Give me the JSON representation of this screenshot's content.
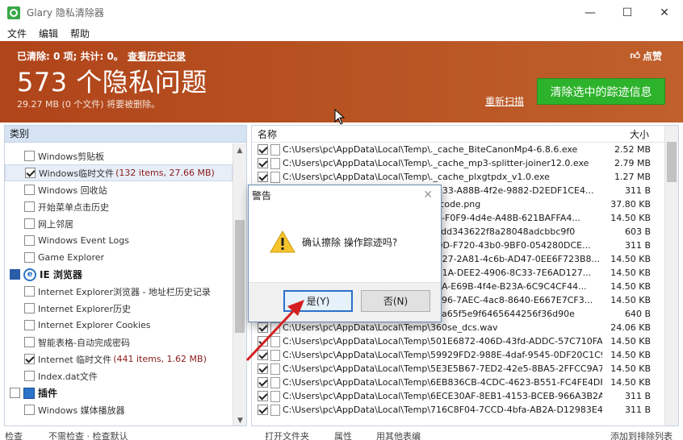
{
  "window": {
    "title": "Glary 隐私清除器",
    "controls": [
      "—",
      "☐",
      "✕"
    ]
  },
  "menu": [
    "文件",
    "编辑",
    "帮助"
  ],
  "banner": {
    "summary": "已清除: 0 项; 共计: 0。",
    "history_link": "查看历史记录",
    "like": "点赞",
    "count": "573 个隐私问题",
    "sub": "29.27 MB (0 个文件) 将要被删除。",
    "rescan": "重新扫描",
    "clean_button": "清除选中的踪迹信息"
  },
  "left_panel": {
    "header": "类别",
    "items": [
      {
        "label": "Windows剪贴板",
        "checked": false,
        "extra": ""
      },
      {
        "label": "Windows临时文件",
        "checked": true,
        "extra": "(132 items, 27.66 MB)",
        "selected": true
      },
      {
        "label": "Windows 回收站",
        "checked": false,
        "extra": ""
      },
      {
        "label": "开始菜单点击历史",
        "checked": false,
        "extra": ""
      },
      {
        "label": "网上邻居",
        "checked": false,
        "extra": ""
      },
      {
        "label": "Windows Event Logs",
        "checked": false,
        "extra": ""
      },
      {
        "label": "Game Explorer",
        "checked": false,
        "extra": ""
      }
    ],
    "group_ie": "IE 浏览器",
    "ie_items": [
      {
        "label": "Internet Explorer浏览器 - 地址栏历史记录",
        "checked": false,
        "extra": ""
      },
      {
        "label": "Internet Explorer历史",
        "checked": false,
        "extra": ""
      },
      {
        "label": "Internet Explorer Cookies",
        "checked": false,
        "extra": ""
      },
      {
        "label": "智能表格-自动完成密码",
        "checked": false,
        "extra": ""
      },
      {
        "label": "Internet 临时文件",
        "checked": true,
        "extra": "(441 items, 1.62 MB)"
      },
      {
        "label": "Index.dat文件",
        "checked": false,
        "extra": ""
      }
    ],
    "group_plugins": "插件",
    "plugin_items": [
      {
        "label": "Windows 媒体播放器",
        "checked": false,
        "extra": ""
      }
    ]
  },
  "right_panel": {
    "col_name": "名称",
    "col_size": "大小",
    "rows": [
      {
        "path": "C:\\Users\\pc\\AppData\\Local\\Temp\\._cache_BiteCanonMp4-6.8.6.exe",
        "size": "2.52 MB"
      },
      {
        "path": "C:\\Users\\pc\\AppData\\Local\\Temp\\._cache_mp3-splitter-joiner12.0.exe",
        "size": "2.79 MB"
      },
      {
        "path": "C:\\Users\\pc\\AppData\\Local\\Temp\\._cache_plxgtpdx_v1.0.exe",
        "size": "1.27 MB"
      },
      {
        "path": "C:\\Users\\pc\\AppData\\Local\\Temp\\FD33-A88B-4f2e-9882-D2EDF1CE4...",
        "size": "311 B"
      },
      {
        "path": "C:\\Users\\pc\\AppData\\Local\\Temp\\qrcode.png",
        "size": "37.80 KB"
      },
      {
        "path": "C:\\Users\\pc\\AppData\\Local\\Temp\\36-F0F9-4d4e-A48B-621BAFFA4...",
        "size": "14.50 KB"
      },
      {
        "path": "C:\\Users\\pc\\AppData\\Local\\Temp\\2cdd343622f8a28048adcbbc9f0",
        "size": "603 B"
      },
      {
        "path": "C:\\Users\\pc\\AppData\\Local\\Temp\\6DD-F720-43b0-9BF0-054280DCE...",
        "size": "311 B"
      },
      {
        "path": "C:\\Users\\pc\\AppData\\Local\\Temp\\6B27-2A81-4c6b-AD47-0EE6F723B8...",
        "size": "14.50 KB"
      },
      {
        "path": "C:\\Users\\pc\\AppData\\Local\\Temp\\8B1A-DEE2-4906-8C33-7E6AD127...",
        "size": "14.50 KB"
      },
      {
        "path": "C:\\Users\\pc\\AppData\\Local\\Temp\\7EA-E69B-4f4e-B23A-6C9C4CF44...",
        "size": "14.50 KB"
      },
      {
        "path": "C:\\Users\\pc\\AppData\\Local\\Temp\\FC96-7AEC-4ac8-8640-E667E7CF3...",
        "size": "14.50 KB"
      },
      {
        "path": "C:\\Users\\pc\\AppData\\Local\\Temp\\6ba65f5e9f6465644256f36d90e",
        "size": "640 B"
      },
      {
        "path": "C:\\Users\\pc\\AppData\\Local\\Temp\\360se_dcs.wav",
        "size": "24.06 KB"
      },
      {
        "path": "C:\\Users\\pc\\AppData\\Local\\Temp\\501E6872-406D-43fd-ADDC-57C710FADA...",
        "size": "14.50 KB"
      },
      {
        "path": "C:\\Users\\pc\\AppData\\Local\\Temp\\59929FD2-988E-4daf-9545-0DF20C1C9F...",
        "size": "14.50 KB"
      },
      {
        "path": "C:\\Users\\pc\\AppData\\Local\\Temp\\5E3E5B67-7ED2-42e5-8BA5-2FFCC9A74...",
        "size": "14.50 KB"
      },
      {
        "path": "C:\\Users\\pc\\AppData\\Local\\Temp\\6EB836CB-4CDC-4623-B551-FC4FE4DF8...",
        "size": "14.50 KB"
      },
      {
        "path": "C:\\Users\\pc\\AppData\\Local\\Temp\\6ECE30AF-8EB1-4153-BCEB-966A3B2A6...",
        "size": "311 B"
      },
      {
        "path": "C:\\Users\\pc\\AppData\\Local\\Temp\\716C8F04-7CCD-4bfa-AB2A-D12983E49...",
        "size": "311 B"
      }
    ]
  },
  "bottom": {
    "left": "检查",
    "mid": "不需检查 · 检查默认",
    "open_folder": "打开文件夹",
    "props": "属性",
    "open_with": "用其他表编",
    "right": "添加到排除列表"
  },
  "dialog": {
    "title": "警告",
    "message": "确认擦除  操作踪迹吗?",
    "yes": "是(Y)",
    "no": "否(N)"
  },
  "colors": {
    "banner": "#b85423",
    "clean_button": "#2db32b",
    "panel_header": "#d5e3f4",
    "arrow": "#d42020"
  }
}
